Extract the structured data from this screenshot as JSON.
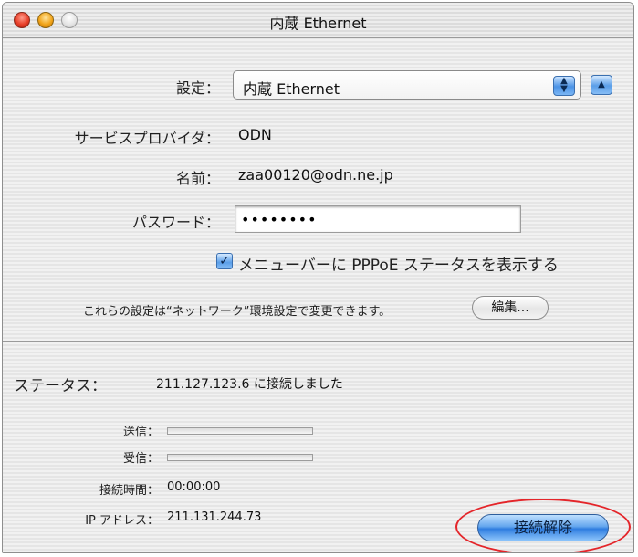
{
  "window": {
    "title": "内蔵 Ethernet"
  },
  "settings": {
    "config_label": "設定：",
    "config_value": "内蔵 Ethernet",
    "provider_label": "サービスプロバイダ：",
    "provider_value": "ODN",
    "name_label": "名前：",
    "name_value": "zaa00120@odn.ne.jp",
    "password_label": "パスワード：",
    "password_value": "••••••••",
    "menubar_checkbox_label": "メニューバーに PPPoE ステータスを表示する",
    "menubar_checkbox_checked": true,
    "note_text": "これらの設定は“ネットワーク”環境設定で変更できます。",
    "edit_button_label": "編集..."
  },
  "status": {
    "status_label": "ステータス：",
    "status_value": "211.127.123.6 に接続しました",
    "sent_label": "送信：",
    "received_label": "受信：",
    "connect_time_label": "接続時間：",
    "connect_time_value": "00:00:00",
    "ip_label": "IP アドレス：",
    "ip_value": "211.131.244.73",
    "disconnect_button_label": "接続解除"
  },
  "colors": {
    "accent": "#4b93e6",
    "highlight_ring": "#e4252a"
  }
}
